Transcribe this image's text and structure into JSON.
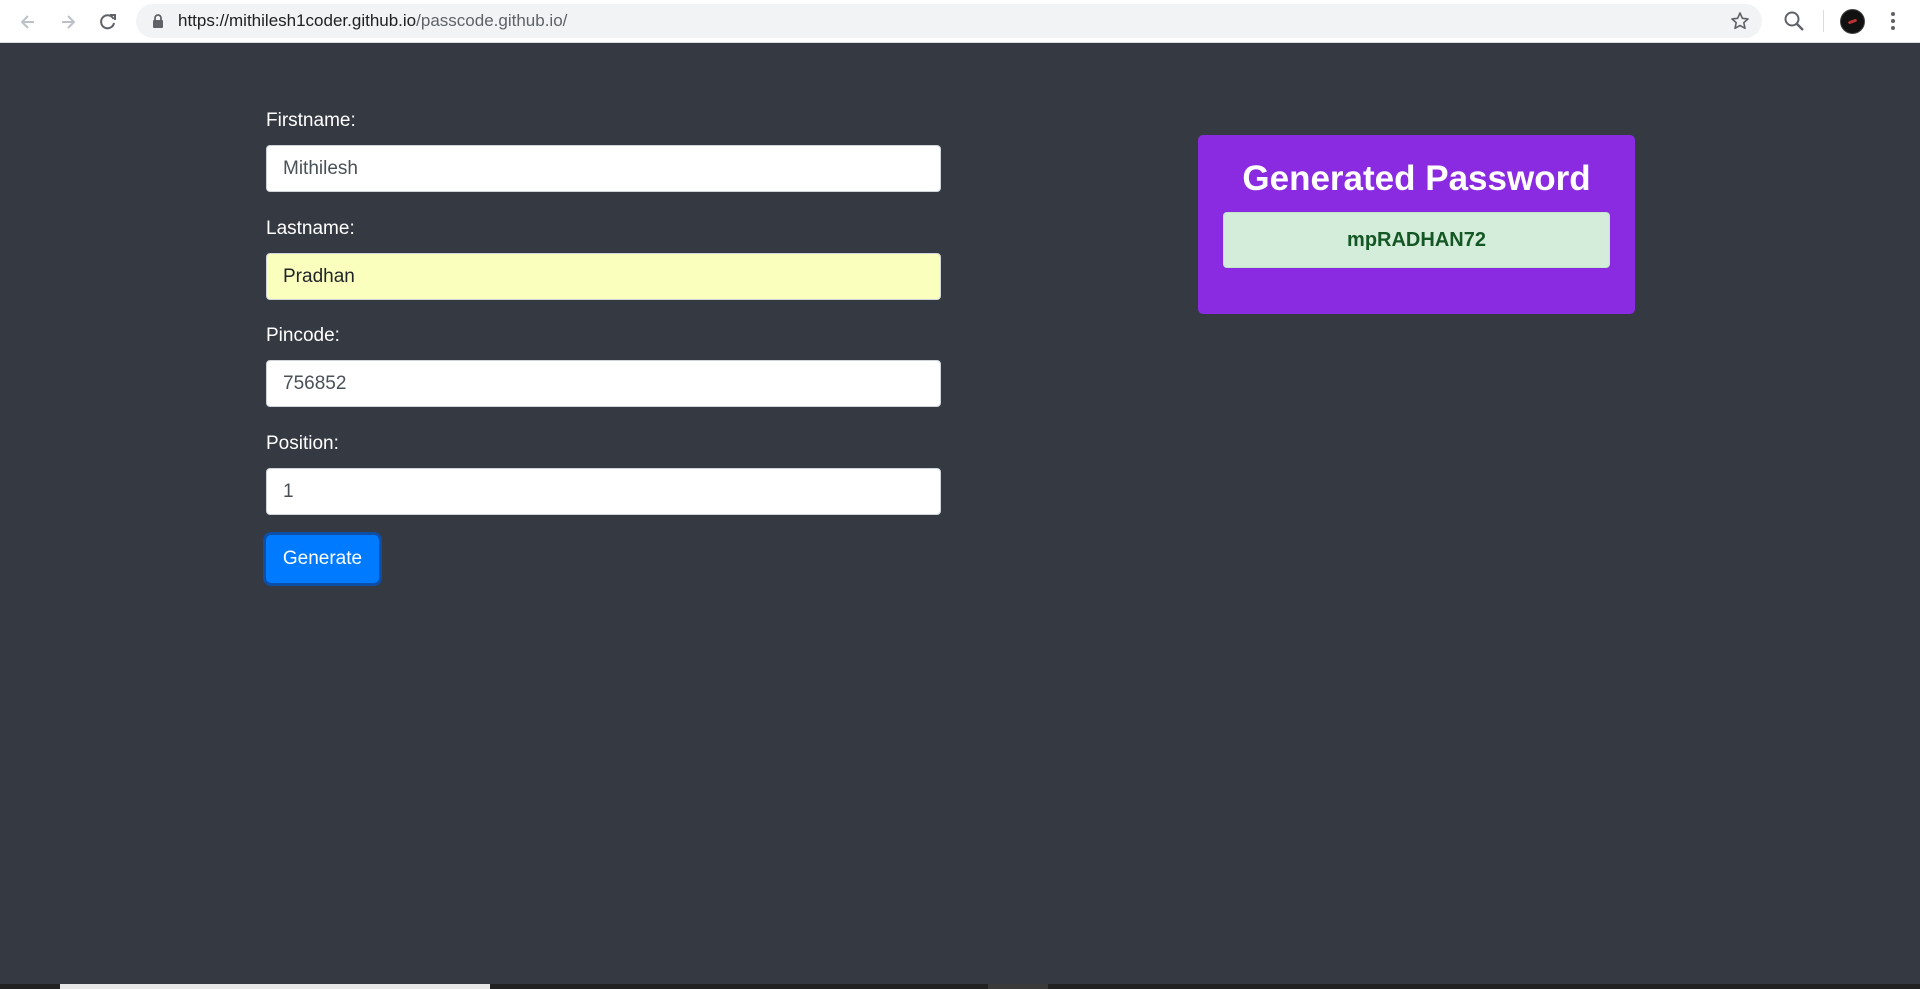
{
  "browser": {
    "url_host": "https://mithilesh1coder.github.io",
    "url_path": "/passcode.github.io/"
  },
  "form": {
    "firstname_label": "Firstname:",
    "firstname_value": "Mithilesh",
    "lastname_label": "Lastname:",
    "lastname_value": "Pradhan",
    "pincode_label": "Pincode:",
    "pincode_value": "756852",
    "position_label": "Position:",
    "position_value": "1",
    "generate_label": "Generate"
  },
  "result": {
    "title": "Generated Password",
    "password": "mpRADHAN72"
  },
  "colors": {
    "page_background": "#353942",
    "card_background": "#8a2be2",
    "button_primary": "#007bff",
    "result_box": "#d4edda",
    "autofill": "#faffbd"
  },
  "icons": [
    "back-arrow-icon",
    "forward-arrow-icon",
    "reload-icon",
    "lock-icon",
    "star-icon",
    "search-icon",
    "menu-icon"
  ]
}
